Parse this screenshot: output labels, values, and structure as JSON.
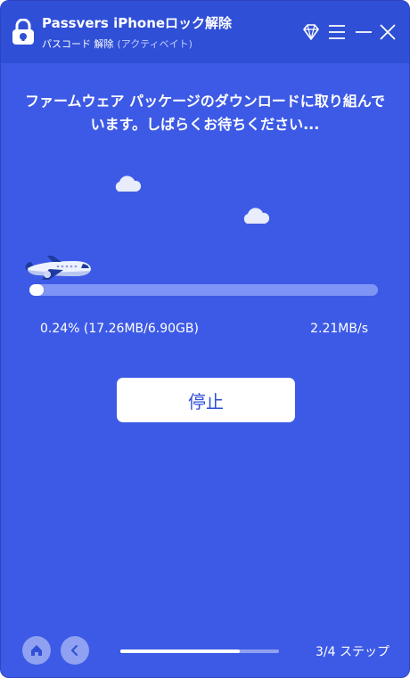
{
  "window": {
    "title": "Passvers iPhoneロック解除",
    "subtitle_main": "パスコード 解除",
    "subtitle_mode": "(アクティベイト)"
  },
  "titlebar_icons": [
    "diamond-icon",
    "menu-icon",
    "minimize-icon",
    "close-icon"
  ],
  "main": {
    "message": "ファームウェア パッケージのダウンロードに取り組んでいます。しばらくお待ちください...",
    "progress_text": "0.24% (17.26MB/6.90GB)",
    "progress_fraction": 0.0024,
    "speed": "2.21MB/s",
    "stop_label": "停止"
  },
  "footer": {
    "step_label": "3/4 ステップ",
    "step_fraction": 0.75
  },
  "colors": {
    "background": "#3d5ae6",
    "titlebar": "#2f4fd6",
    "accent_text": "#2f4fd6"
  }
}
